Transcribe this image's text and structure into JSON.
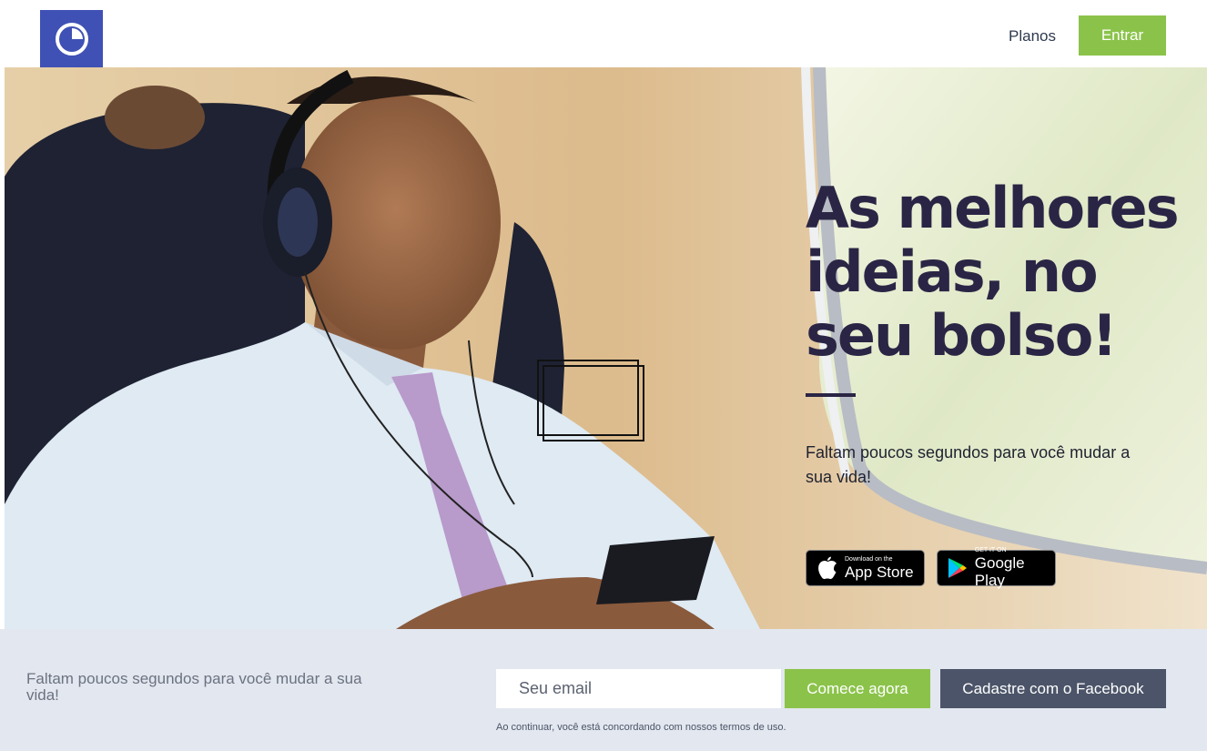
{
  "header": {
    "logo_icon": "pie-clock-icon",
    "nav_link": "Planos",
    "login_button": "Entrar"
  },
  "hero": {
    "headline_lines": [
      "As melhores",
      "ideias, no",
      "seu bolso!"
    ],
    "subtitle": "Faltam poucos segundos para você mudar a sua vida!",
    "app_store": {
      "small": "Download on the",
      "big": "App Store",
      "icon": "apple-icon"
    },
    "google_play": {
      "small": "GET IT ON",
      "big": "Google Play",
      "icon": "google-play-icon"
    }
  },
  "signup": {
    "text": "Faltam poucos segundos para você mudar a sua vida!",
    "email_placeholder": "Seu email",
    "start_button": "Comece agora",
    "facebook_button": "Cadastre com o Facebook",
    "terms": "Ao continuar, você está concordando com nossos termos de uso."
  },
  "colors": {
    "brand_blue": "#3f51b5",
    "accent_green": "#8bc34a",
    "facebook_slate": "#4b5468",
    "headline": "#2a2545",
    "bar_background": "#e3e7ef"
  }
}
